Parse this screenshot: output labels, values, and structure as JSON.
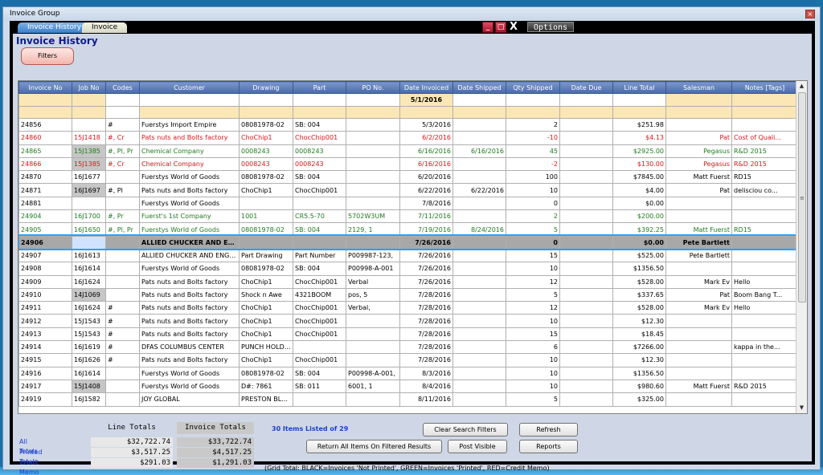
{
  "window": {
    "title": "Invoice Group",
    "close_glyph": "×"
  },
  "tabs": [
    {
      "label": "Invoice History"
    },
    {
      "label": "Invoice"
    }
  ],
  "options_label": "Options",
  "heading": "Invoice History",
  "filters_label": "Filters",
  "columns": [
    "Invoice No",
    "Job No",
    "Codes",
    "Customer",
    "Drawing",
    "Part",
    "PO No.",
    "Date Invoiced",
    "Date Shipped",
    "Qty Shipped",
    "Date Due",
    "Line Total",
    "Salesman",
    "Notes [Tags]"
  ],
  "filter_date_invoiced": "5/1/2016",
  "rows": [
    {
      "status": "black",
      "inv": "24856",
      "job": "",
      "codes": "#",
      "customer": "Fuerstys Import Empire",
      "drawing": "08081978-02",
      "part": "SB: 004",
      "po": "",
      "dinv": "5/3/2016",
      "dship": "",
      "qty": "2",
      "due": "",
      "total": "$251.98",
      "sales": "",
      "notes": ""
    },
    {
      "status": "red",
      "inv": "24860",
      "job": "15J1418",
      "codes": "#, Cr",
      "customer": "Pats nuts and Bolts factory",
      "drawing": "ChoChip1",
      "part": "ChocChip001",
      "po": "",
      "dinv": "6/2/2016",
      "dship": "",
      "qty": "-10",
      "due": "",
      "total": "$4.13",
      "sales": "Pat",
      "notes": "Cost of Quali..."
    },
    {
      "status": "green",
      "inv": "24865",
      "job": "15J1385",
      "codes": "#, Pl, Pr",
      "customer": "Chemical Company",
      "drawing": "0008243",
      "part": "0008243",
      "po": "",
      "dinv": "6/16/2016",
      "dship": "6/16/2016",
      "qty": "45",
      "due": "",
      "total": "$2925.00",
      "sales": "Pegasus",
      "notes": "R&D 2015",
      "jobgray": true
    },
    {
      "status": "red",
      "inv": "24866",
      "job": "15J1385",
      "codes": "#, Cr",
      "customer": "Chemical Company",
      "drawing": "0008243",
      "part": "0008243",
      "po": "",
      "dinv": "6/16/2016",
      "dship": "",
      "qty": "-2",
      "due": "",
      "total": "$130.00",
      "sales": "Pegasus",
      "notes": "R&D 2015",
      "jobgray": true
    },
    {
      "status": "black",
      "inv": "24870",
      "job": "16J1677",
      "codes": "",
      "customer": "Fuerstys World of Goods",
      "drawing": "08081978-02",
      "part": "SB: 004",
      "po": "",
      "dinv": "6/20/2016",
      "dship": "",
      "qty": "100",
      "due": "",
      "total": "$7845.00",
      "sales": "Matt Fuerst",
      "notes": "RD15"
    },
    {
      "status": "black",
      "inv": "24871",
      "job": "16J1697",
      "codes": "#, Pl",
      "customer": "Pats nuts and Bolts factory",
      "drawing": "ChoChip1",
      "part": "ChocChip001",
      "po": "",
      "dinv": "6/22/2016",
      "dship": "6/22/2016",
      "qty": "10",
      "due": "",
      "total": "$4.00",
      "sales": "Pat",
      "notes": "delisciou co...",
      "jobgray": true
    },
    {
      "status": "black",
      "inv": "24881",
      "job": "",
      "codes": "",
      "customer": "Fuerstys World of Goods",
      "drawing": "",
      "part": "",
      "po": "",
      "dinv": "7/8/2016",
      "dship": "",
      "qty": "0",
      "due": "",
      "total": "$0.00",
      "sales": "",
      "notes": ""
    },
    {
      "status": "green",
      "inv": "24904",
      "job": "16J1700",
      "codes": "#, Pr",
      "customer": "Fuerst's 1st Company",
      "drawing": "1001",
      "part": "CR5.5-70",
      "po": "5702W3UM",
      "dinv": "7/11/2016",
      "dship": "",
      "qty": "2",
      "due": "",
      "total": "$200.00",
      "sales": "",
      "notes": ""
    },
    {
      "status": "green",
      "inv": "24905",
      "job": "16J1650",
      "codes": "#, Pl, Pr",
      "customer": "Fuerstys World of Goods",
      "drawing": "08081978-02",
      "part": "SB: 004",
      "po": "2129, 1",
      "dinv": "7/19/2016",
      "dship": "8/24/2016",
      "qty": "5",
      "due": "",
      "total": "$392.25",
      "sales": "Matt Fuerst",
      "notes": "RD15"
    },
    {
      "status": "sel",
      "inv": "24906",
      "job": "",
      "codes": "",
      "customer": "ALLIED CHUCKER AND ENGI...",
      "drawing": "",
      "part": "",
      "po": "",
      "dinv": "7/26/2016",
      "dship": "",
      "qty": "0",
      "due": "",
      "total": "$0.00",
      "sales": "Pete Bartlett",
      "notes": ""
    },
    {
      "status": "black",
      "inv": "24907",
      "job": "16J1613",
      "codes": "",
      "customer": "ALLIED CHUCKER AND ENGI...",
      "drawing": "Part Drawing",
      "part": "Part Number",
      "po": "P009987-123,",
      "dinv": "7/26/2016",
      "dship": "",
      "qty": "15",
      "due": "",
      "total": "$525.00",
      "sales": "Pete Bartlett",
      "notes": ""
    },
    {
      "status": "black",
      "inv": "24908",
      "job": "16J1614",
      "codes": "",
      "customer": "Fuerstys World of Goods",
      "drawing": "08081978-02",
      "part": "SB: 004",
      "po": "P00998-A-001",
      "dinv": "7/26/2016",
      "dship": "",
      "qty": "10",
      "due": "",
      "total": "$1356.50",
      "sales": "",
      "notes": ""
    },
    {
      "status": "black",
      "inv": "24909",
      "job": "16J1624",
      "codes": "",
      "customer": "Pats nuts and Bolts factory",
      "drawing": "ChoChip1",
      "part": "ChocChip001",
      "po": "Verbal",
      "dinv": "7/26/2016",
      "dship": "",
      "qty": "12",
      "due": "",
      "total": "$528.00",
      "sales": "Mark Ev",
      "notes": "Hello"
    },
    {
      "status": "black",
      "inv": "24910",
      "job": "14J1069",
      "codes": "",
      "customer": "Pats nuts and Bolts factory",
      "drawing": "Shock n Awe",
      "part": "4321BOOM",
      "po": "pos, 5",
      "dinv": "7/28/2016",
      "dship": "",
      "qty": "5",
      "due": "",
      "total": "$337.65",
      "sales": "Pat",
      "notes": "Boom Bang T...",
      "jobgray": true
    },
    {
      "status": "black",
      "inv": "24911",
      "job": "16J1624",
      "codes": "#",
      "customer": "Pats nuts and Bolts factory",
      "drawing": "ChoChip1",
      "part": "ChocChip001",
      "po": "Verbal,",
      "dinv": "7/28/2016",
      "dship": "",
      "qty": "12",
      "due": "",
      "total": "$528.00",
      "sales": "Mark Ev",
      "notes": "Hello"
    },
    {
      "status": "black",
      "inv": "24912",
      "job": "15J1543",
      "codes": "#",
      "customer": "Pats nuts and Bolts factory",
      "drawing": "ChoChip1",
      "part": "ChocChip001",
      "po": "",
      "dinv": "7/28/2016",
      "dship": "",
      "qty": "10",
      "due": "",
      "total": "$12.30",
      "sales": "",
      "notes": ""
    },
    {
      "status": "black",
      "inv": "24913",
      "job": "15J1543",
      "codes": "#",
      "customer": "Pats nuts and Bolts factory",
      "drawing": "ChoChip1",
      "part": "ChocChip001",
      "po": "",
      "dinv": "7/28/2016",
      "dship": "",
      "qty": "15",
      "due": "",
      "total": "$18.45",
      "sales": "",
      "notes": ""
    },
    {
      "status": "black",
      "inv": "24914",
      "job": "16J1619",
      "codes": "#",
      "customer": "DFAS COLUMBUS CENTER",
      "drawing": "PUNCH HOLD...",
      "part": "",
      "po": "",
      "dinv": "7/28/2016",
      "dship": "",
      "qty": "6",
      "due": "",
      "total": "$7266.00",
      "sales": "",
      "notes": "kappa in the..."
    },
    {
      "status": "black",
      "inv": "24915",
      "job": "16J1626",
      "codes": "#",
      "customer": "Pats nuts and Bolts factory",
      "drawing": "ChoChip1",
      "part": "ChocChip001",
      "po": "",
      "dinv": "7/28/2016",
      "dship": "",
      "qty": "10",
      "due": "",
      "total": "$12.30",
      "sales": "",
      "notes": ""
    },
    {
      "status": "black",
      "inv": "24916",
      "job": "16J1614",
      "codes": "",
      "customer": "Fuerstys World of Goods",
      "drawing": "08081978-02",
      "part": "SB: 004",
      "po": "P00998-A-001,",
      "dinv": "8/3/2016",
      "dship": "",
      "qty": "10",
      "due": "",
      "total": "$1356.50",
      "sales": "",
      "notes": ""
    },
    {
      "status": "black",
      "inv": "24917",
      "job": "15J1408",
      "codes": "",
      "customer": "Fuerstys World of Goods",
      "drawing": "D#: 7861",
      "part": "SB: 011",
      "po": "6001, 1",
      "dinv": "8/4/2016",
      "dship": "",
      "qty": "10",
      "due": "",
      "total": "$980.60",
      "sales": "Matt Fuerst",
      "notes": "R&D 2015",
      "jobgray": true
    },
    {
      "status": "black",
      "inv": "24919",
      "job": "16J1582",
      "codes": "",
      "customer": "JOY GLOBAL",
      "drawing": "PRESTON BL...",
      "part": "",
      "po": "",
      "dinv": "8/11/2016",
      "dship": "",
      "qty": "5",
      "due": "",
      "total": "$325.00",
      "sales": "",
      "notes": ""
    }
  ],
  "totals": {
    "head_line": "Line Totals",
    "head_invoice": "Invoice Totals",
    "rows": [
      {
        "label": "All Totals",
        "line": "$32,722.74",
        "invoice": "$33,722.74"
      },
      {
        "label": "Printed Totals",
        "line": "$3,517.25",
        "invoice": "$4,517.25"
      },
      {
        "label": "Credit Memo Totals",
        "line": "$291.03",
        "invoice": "$1,291.03"
      }
    ]
  },
  "items_listed": "30 Items Listed of 29",
  "buttons": {
    "clear_filters": "Clear Search Filters",
    "refresh": "Refresh",
    "return_all": "Return All Items On Filtered Results",
    "post_visible": "Post Visible",
    "reports": "Reports"
  },
  "legend": "(Grid Total: BLACK=Invoices 'Not Printed', GREEN=Invoices 'Printed', RED=Credit Memo)",
  "colors": {
    "black": "#000000",
    "green": "#1f7a1f",
    "red": "#e0141a",
    "header": "#4a6aa8",
    "filter_row": "#fbe7b5"
  },
  "window_buttons": {
    "minimize": "_",
    "maximize": "□",
    "close": "X"
  }
}
